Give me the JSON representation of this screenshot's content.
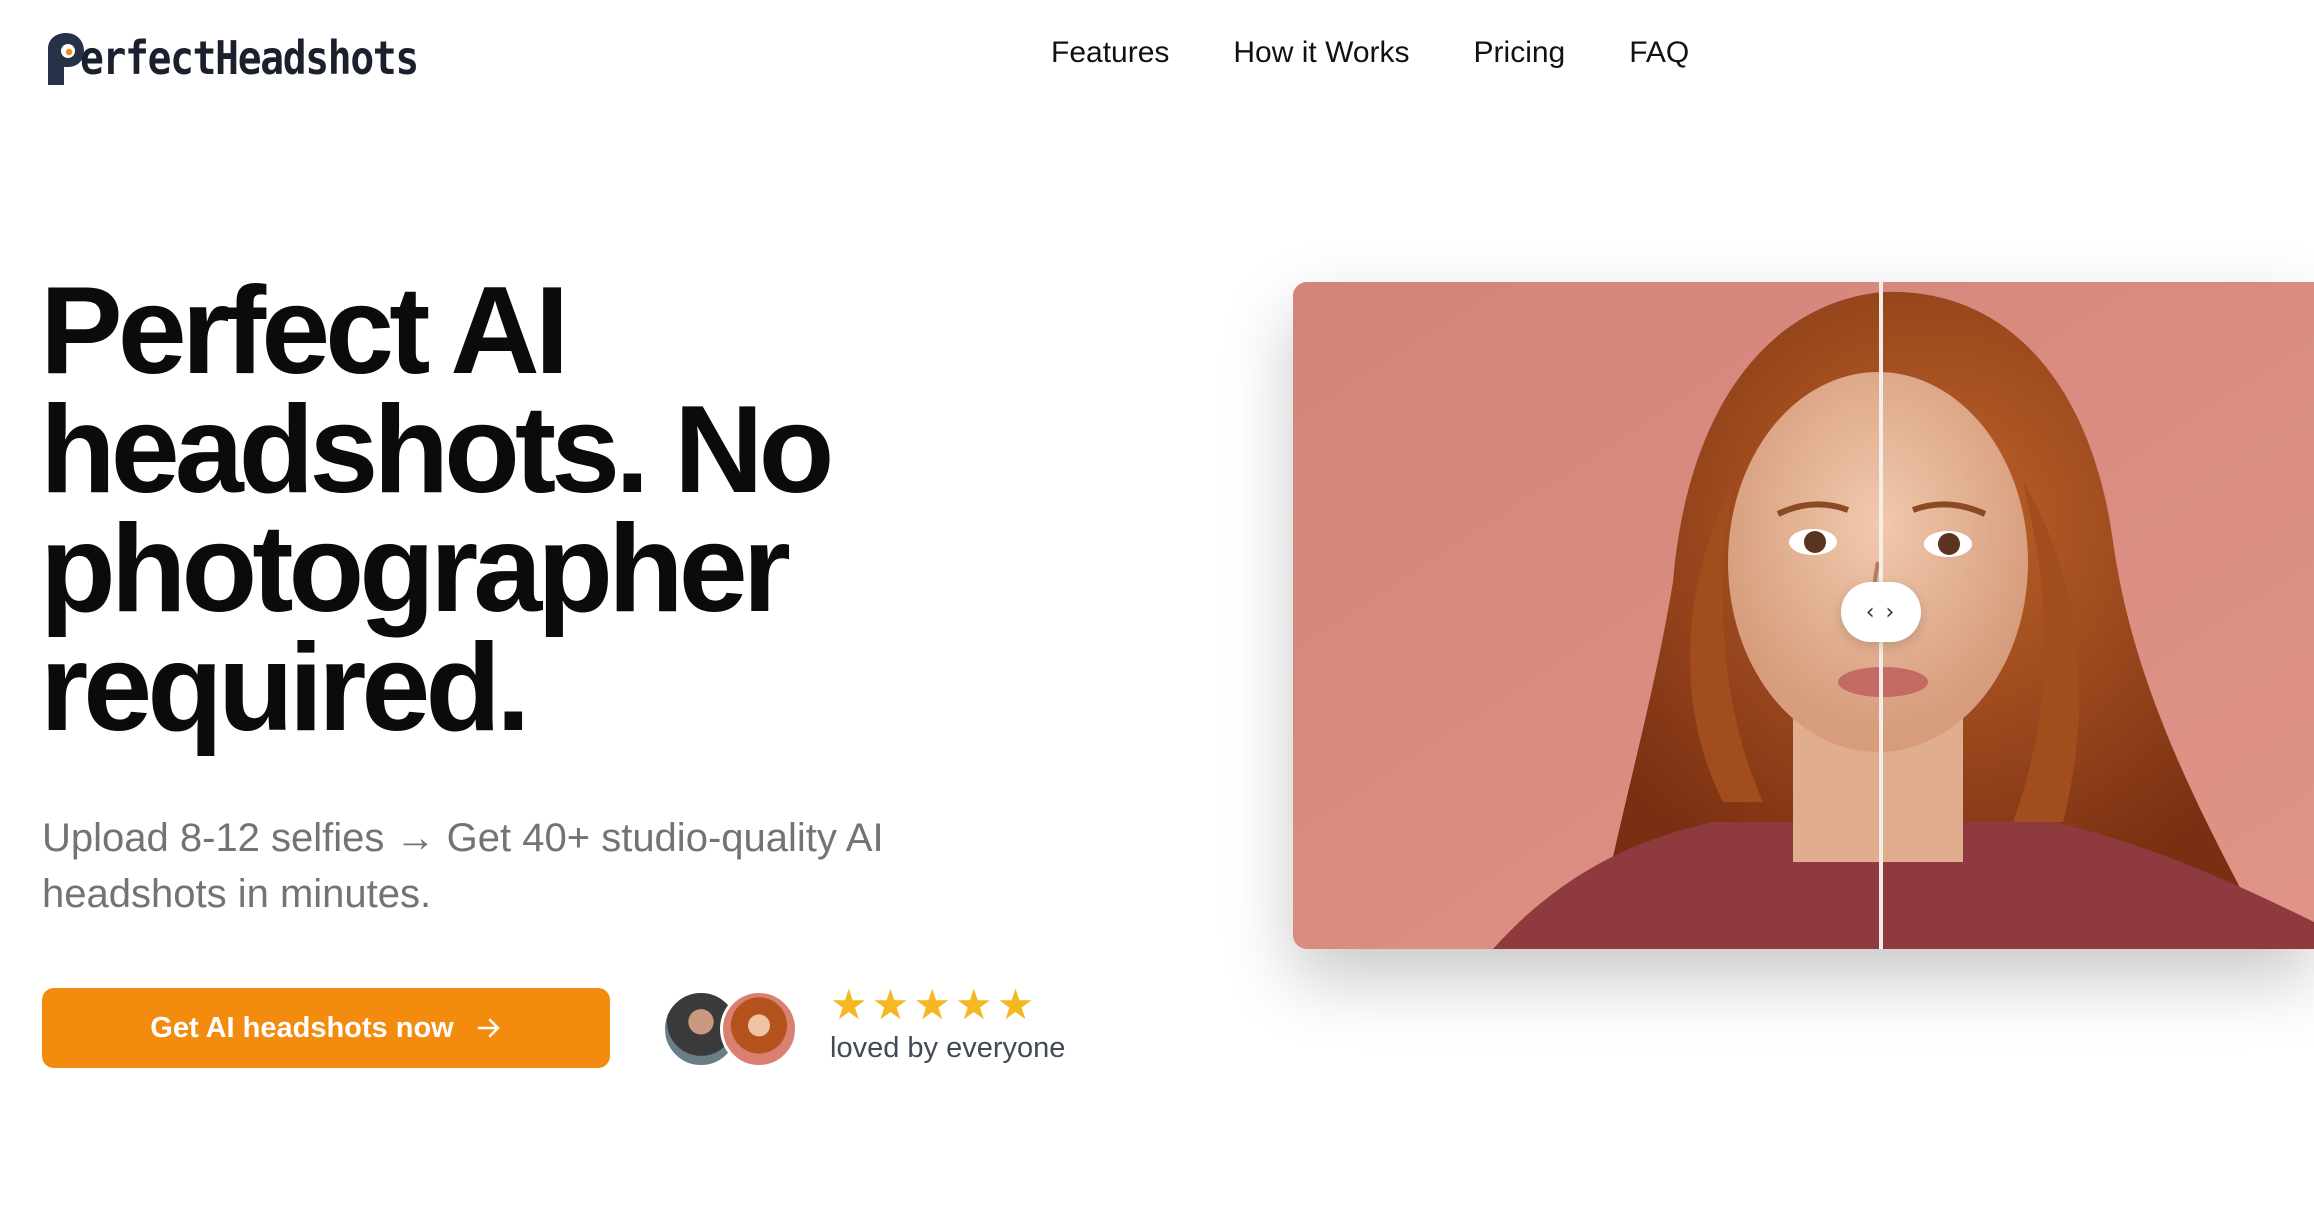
{
  "brand": {
    "name": "erfectHeadshots",
    "mark_letter": "P"
  },
  "nav": {
    "items": [
      "Features",
      "How it Works",
      "Pricing",
      "FAQ"
    ]
  },
  "hero": {
    "headline": "Perfect AI headshots. No photographer required.",
    "subheadline": "Upload 8-12 selfies → Get 40+ studio-quality AI headshots in minutes.",
    "cta_label": "Get AI headshots now",
    "rating_stars": 5,
    "rating_caption": "loved by everyone"
  },
  "compare": {
    "handle_glyph": "‹ ›",
    "split_position": 0.576
  },
  "colors": {
    "accent": "#f38b0e",
    "star": "#f6b821",
    "photo_background": "#d98a7d"
  },
  "icons": {
    "cta_arrow": "arrow-right-icon",
    "handle": "chevron-left-right-icon",
    "stars": "star-icon"
  }
}
